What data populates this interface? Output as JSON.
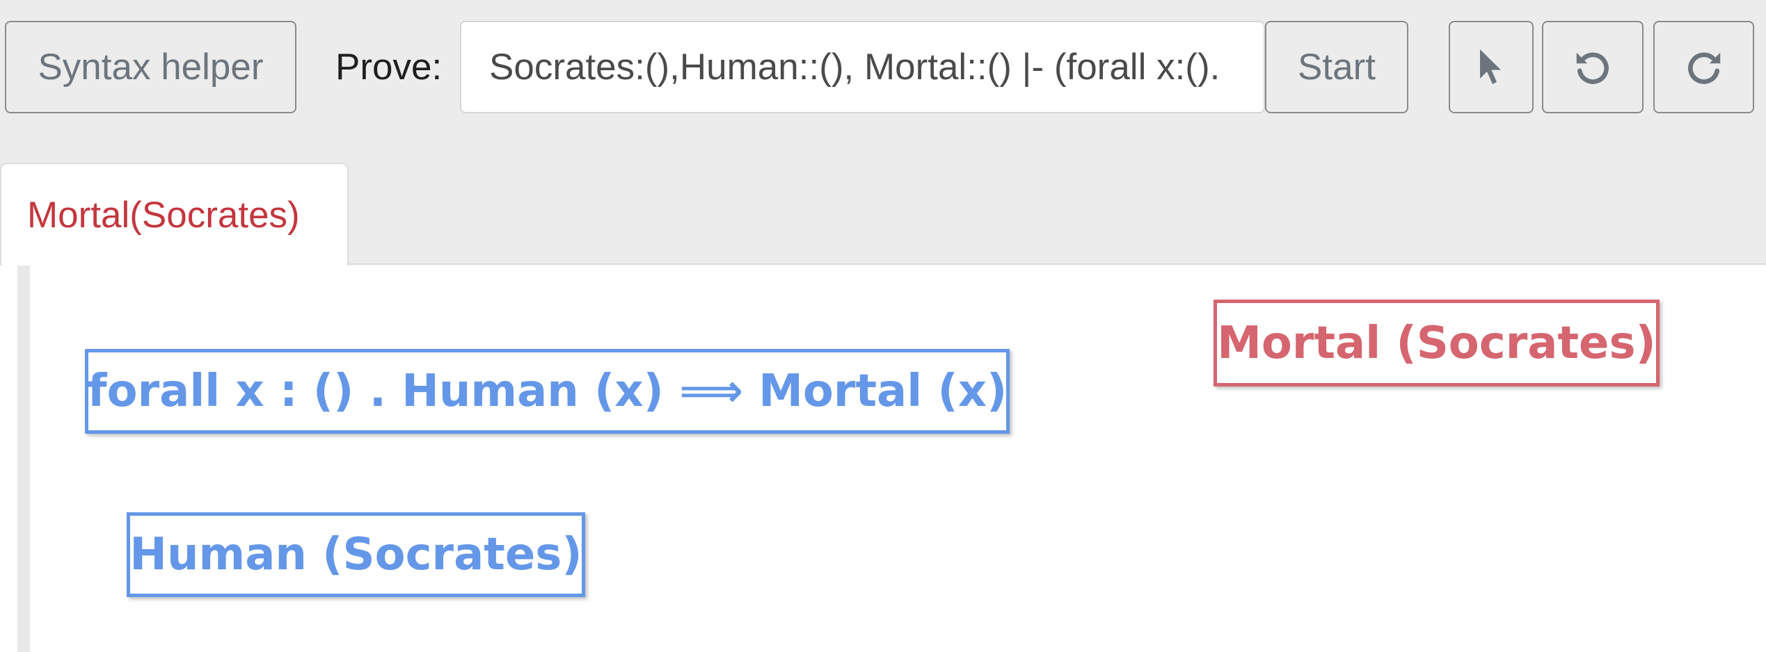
{
  "toolbar": {
    "syntax_helper_label": "Syntax helper",
    "prove_label": "Prove:",
    "prove_input_value": "Socrates:(),Human::(), Mortal::() |- (forall x:().",
    "start_label": "Start",
    "icons": [
      "cursor-icon",
      "undo-icon",
      "redo-icon"
    ]
  },
  "tabs": [
    {
      "label": "Mortal(Socrates)",
      "active": true
    }
  ],
  "workspace": {
    "hypotheses": [
      {
        "text": "forall x : () . Human (x) ⟹ Mortal (x)"
      },
      {
        "text": "Human (Socrates)"
      }
    ],
    "goals": [
      {
        "text": "Mortal (Socrates)"
      }
    ]
  },
  "colors": {
    "hypothesis": "#6497e8",
    "goal": "#d5656f",
    "tab_label": "#c4363e",
    "background": "#ececec"
  }
}
